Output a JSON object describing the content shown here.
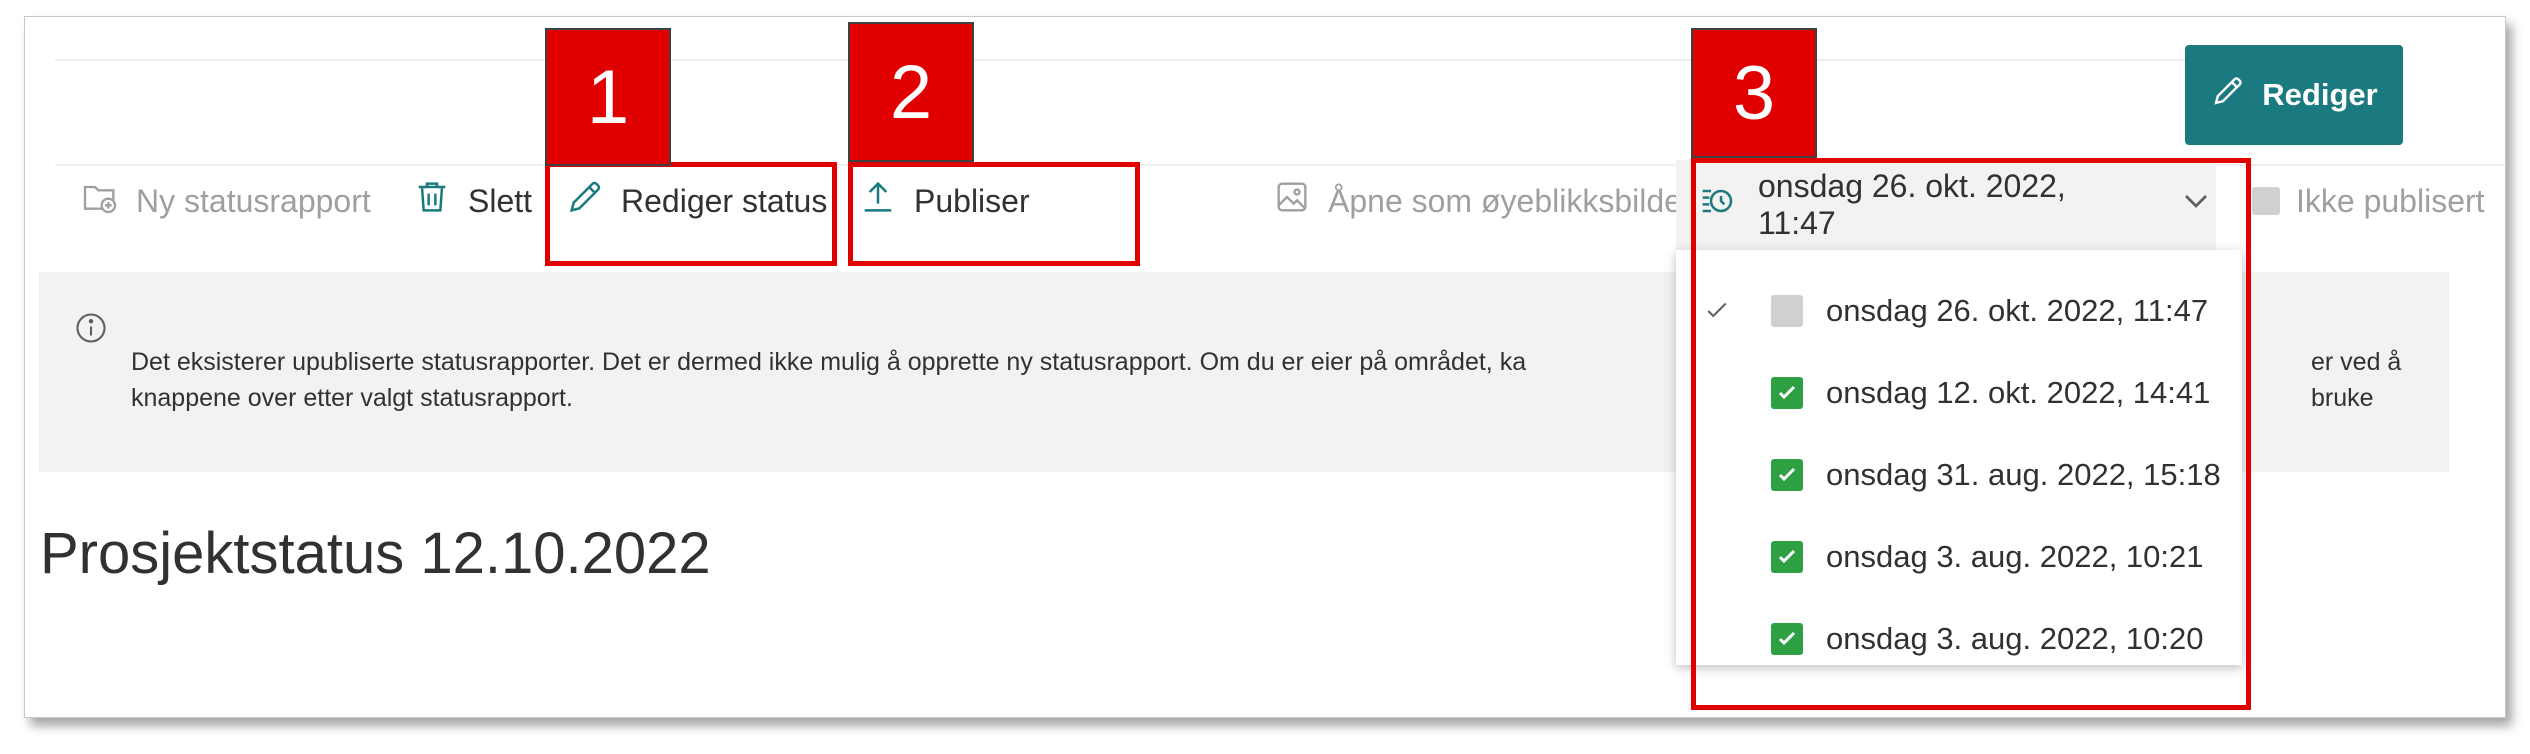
{
  "header": {
    "edit_label": "Rediger"
  },
  "commands": {
    "new_report": "Ny statusrapport",
    "delete": "Slett",
    "edit_status": "Rediger status",
    "publish": "Publiser",
    "snapshot": "Åpne som øyeblikksbilde",
    "not_published": "Ikke publisert"
  },
  "date_selector": {
    "selected": "onsdag 26. okt. 2022, 11:47",
    "options": [
      {
        "label": "onsdag 26. okt. 2022, 11:47",
        "published": false,
        "selected": true
      },
      {
        "label": "onsdag 12. okt. 2022, 14:41",
        "published": true,
        "selected": false
      },
      {
        "label": "onsdag 31. aug. 2022, 15:18",
        "published": true,
        "selected": false
      },
      {
        "label": "onsdag 3. aug. 2022, 10:21",
        "published": true,
        "selected": false
      },
      {
        "label": "onsdag 3. aug. 2022, 10:20",
        "published": true,
        "selected": false
      }
    ]
  },
  "message": {
    "line1": "Det eksisterer upubliserte statusrapporter. Det er dermed ikke mulig å opprette ny statusrapport. Om du er eier på området, ka",
    "line1_end": "er ved å bruke",
    "line2": "knappene over etter valgt statusrapport."
  },
  "page": {
    "title": "Prosjektstatus 12.10.2022"
  },
  "annotations": {
    "badge1": "1",
    "badge2": "2",
    "badge3": "3"
  },
  "colors": {
    "primary": "#1b7a80",
    "annotation": "#e00000",
    "check": "#2ea043"
  }
}
